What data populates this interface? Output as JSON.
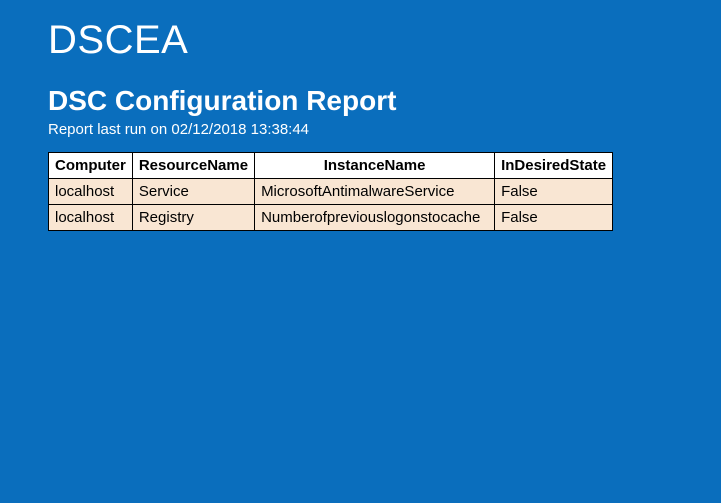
{
  "header": {
    "app_title": "DSCEA"
  },
  "report": {
    "heading": "DSC Configuration Report",
    "timestamp_label": "Report last run on 02/12/2018 13:38:44"
  },
  "table": {
    "columns": [
      "Computer",
      "ResourceName",
      "InstanceName",
      "InDesiredState"
    ],
    "rows": [
      {
        "computer": "localhost",
        "resource_name": "Service",
        "instance_name": "MicrosoftAntimalwareService",
        "in_desired_state": "False"
      },
      {
        "computer": "localhost",
        "resource_name": "Registry",
        "instance_name": "Numberofpreviouslogonstocache",
        "in_desired_state": "False"
      }
    ]
  }
}
